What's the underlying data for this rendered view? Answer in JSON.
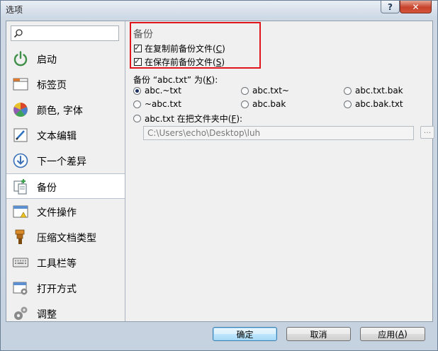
{
  "window": {
    "title": "选项"
  },
  "title_buttons": {
    "help": "?",
    "close": "✕"
  },
  "search": {
    "value": "",
    "placeholder": ""
  },
  "sidebar": {
    "items": [
      {
        "label": "启动",
        "icon": "power-icon"
      },
      {
        "label": "标签页",
        "icon": "tabs-icon"
      },
      {
        "label": "颜色, 字体",
        "icon": "palette-icon"
      },
      {
        "label": "文本编辑",
        "icon": "text-edit-icon"
      },
      {
        "label": "下一个差异",
        "icon": "next-diff-icon"
      },
      {
        "label": "备份",
        "icon": "backup-icon",
        "selected": true
      },
      {
        "label": "文件操作",
        "icon": "file-ops-icon"
      },
      {
        "label": "压缩文档类型",
        "icon": "archive-icon"
      },
      {
        "label": "工具栏等",
        "icon": "keyboard-icon"
      },
      {
        "label": "打开方式",
        "icon": "open-with-icon"
      },
      {
        "label": "调整",
        "icon": "gears-icon"
      }
    ]
  },
  "backup": {
    "section_title": "备份",
    "checkbox_copy": {
      "text": "在复制前备份文件(",
      "key": "C",
      "end": ")",
      "checked": true
    },
    "checkbox_save": {
      "text": "在保存前备份文件(",
      "key": "S",
      "end": ")",
      "checked": true
    },
    "backup_as_label": {
      "text": "备份 “abc.txt” 为(",
      "key": "K",
      "end": "):"
    },
    "name_options": [
      {
        "label": "abc.~txt",
        "checked": true
      },
      {
        "label": "abc.txt~",
        "checked": false
      },
      {
        "label": "abc.txt.bak",
        "checked": false
      },
      {
        "label": "~abc.txt",
        "checked": false
      },
      {
        "label": "abc.bak",
        "checked": false
      },
      {
        "label": "abc.bak.txt",
        "checked": false
      }
    ],
    "folder_option": {
      "text": "abc.txt 在把文件夹中(",
      "key": "F",
      "end": "):",
      "checked": false
    },
    "folder_path": "C:\\Users\\echo\\Desktop\\luh",
    "browse_label": "..."
  },
  "buttons": {
    "ok": "确定",
    "cancel": "取消",
    "apply_text": "应用(",
    "apply_key": "A",
    "apply_end": ")"
  },
  "colors": {
    "highlight_border": "#e0141b",
    "selected_row": "#ffffff",
    "panel_bg": "#f0f0f0"
  }
}
